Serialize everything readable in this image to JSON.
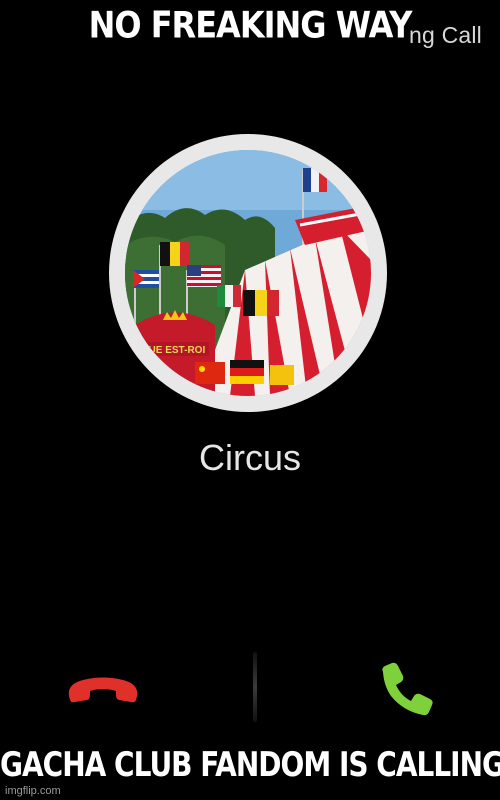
{
  "meme": {
    "top_caption": "NO FREAKING WAY",
    "bottom_caption": "GACHA CLUB FANDOM IS CALLING"
  },
  "call_screen": {
    "status_fragment": "ng Call",
    "contact_name": "Circus",
    "decline_icon": "phone-hangup-icon",
    "accept_icon": "phone-answer-icon",
    "colors": {
      "decline": "#e0302a",
      "accept": "#7fd13b",
      "background": "#000000"
    }
  },
  "avatar_photo": {
    "description_icon": "circus-tent-photo",
    "sign_text": "QUE EST-ROI"
  },
  "watermark": "imgflip.com"
}
